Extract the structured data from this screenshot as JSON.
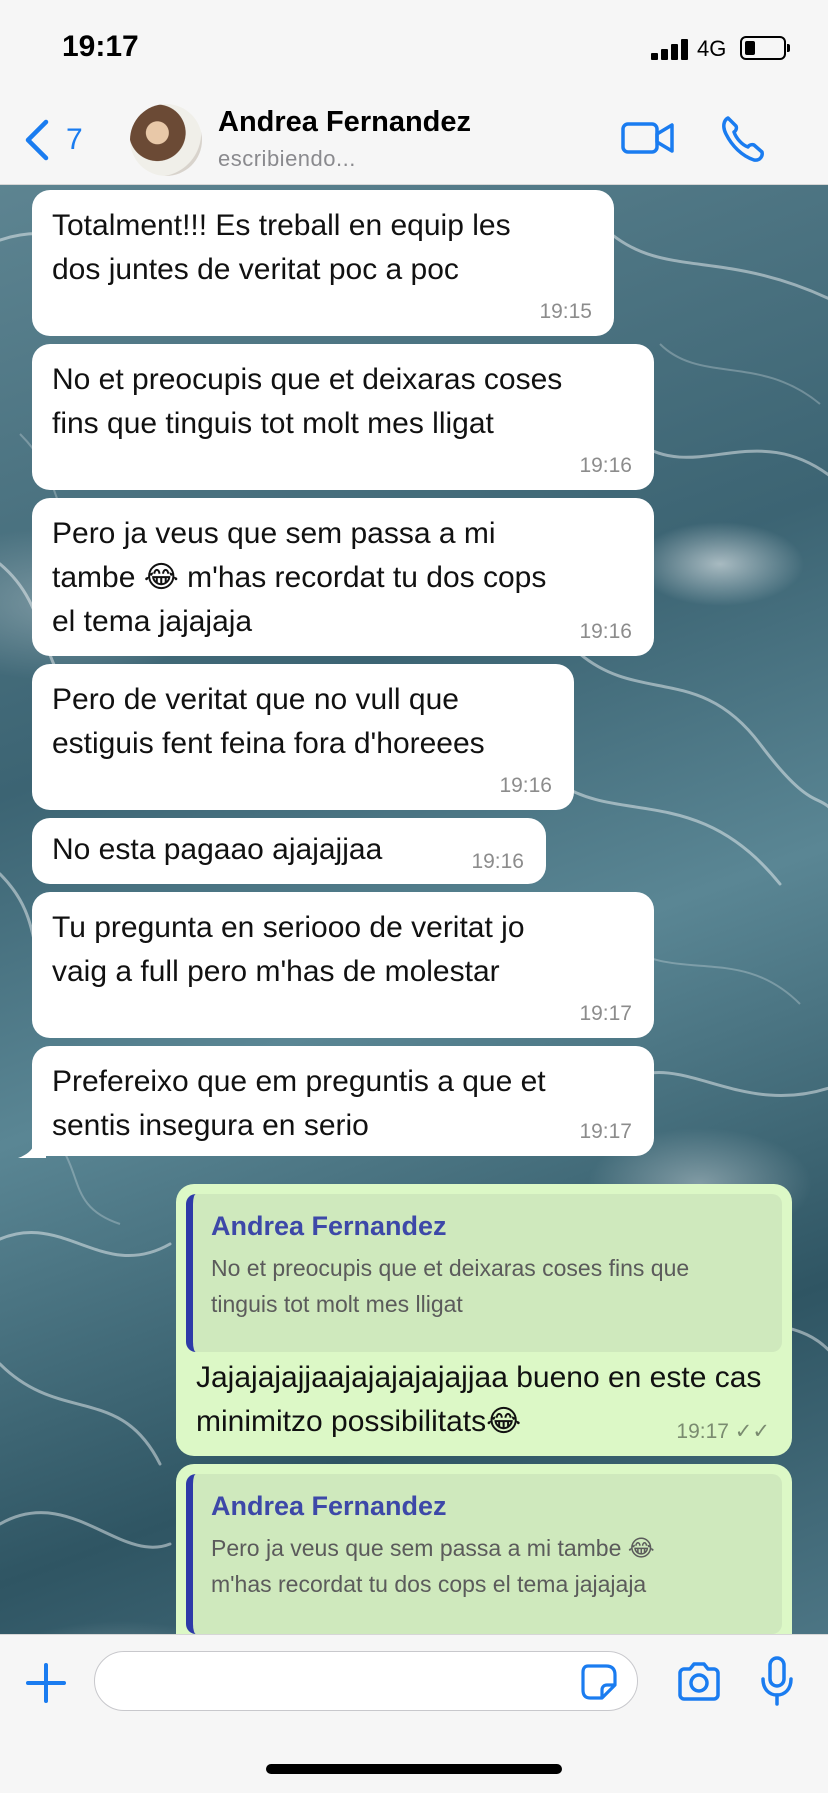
{
  "status_bar": {
    "time": "19:17",
    "network": "4G"
  },
  "header": {
    "back_count": "7",
    "contact_name": "Andrea Fernandez",
    "contact_status": "escribiendo..."
  },
  "messages": [
    {
      "text": "Totalment!!! Es treball en equip les\ndos juntes de veritat poc a poc",
      "time": "19:15"
    },
    {
      "text": "No et preocupis que et deixaras coses\nfins que tinguis tot molt mes lligat",
      "time": "19:16"
    },
    {
      "text": "Pero ja veus que sem passa a mi\ntambe 😂 m'has recordat tu dos cops\nel tema jajajaja",
      "time": "19:16"
    },
    {
      "text": "Pero de veritat que no vull que\nestiguis fent feina fora d'horeees",
      "time": "19:16"
    },
    {
      "text": "No esta pagaao ajajajjaa",
      "time": "19:16"
    },
    {
      "text": "Tu pregunta en seriooo de veritat jo\nvaig a full pero m'has de molestar",
      "time": "19:17"
    },
    {
      "text": "Prefereixo que em preguntis a que et\nsentis insegura en serio",
      "time": "19:17"
    }
  ],
  "replies": [
    {
      "quoted_name": "Andrea Fernandez",
      "quoted_text": "No et preocupis que et deixaras coses fins que\ntinguis tot molt mes lligat",
      "text": "Jajajajajjaajajajajajajjaa bueno en este\ncas minimitzo possibilitats😂",
      "time": "19:17 ✓✓"
    },
    {
      "quoted_name": "Andrea Fernandez",
      "quoted_text": "Pero ja veus que sem passa a mi tambe 😂\nm'has recordat tu dos cops el tema jajajaja"
    }
  ],
  "input": {
    "placeholder": ""
  },
  "icons": {
    "back": "chevron-left-icon",
    "video": "video-camera-icon",
    "call": "phone-icon",
    "plus": "plus-icon",
    "sticker": "sticker-icon",
    "camera": "camera-icon",
    "mic": "microphone-icon"
  },
  "colors": {
    "accent": "#1a7cf0",
    "outgoing_bubble": "#dcf8c6",
    "incoming_bubble": "#ffffff",
    "quote_bar": "#2e3aa8"
  }
}
